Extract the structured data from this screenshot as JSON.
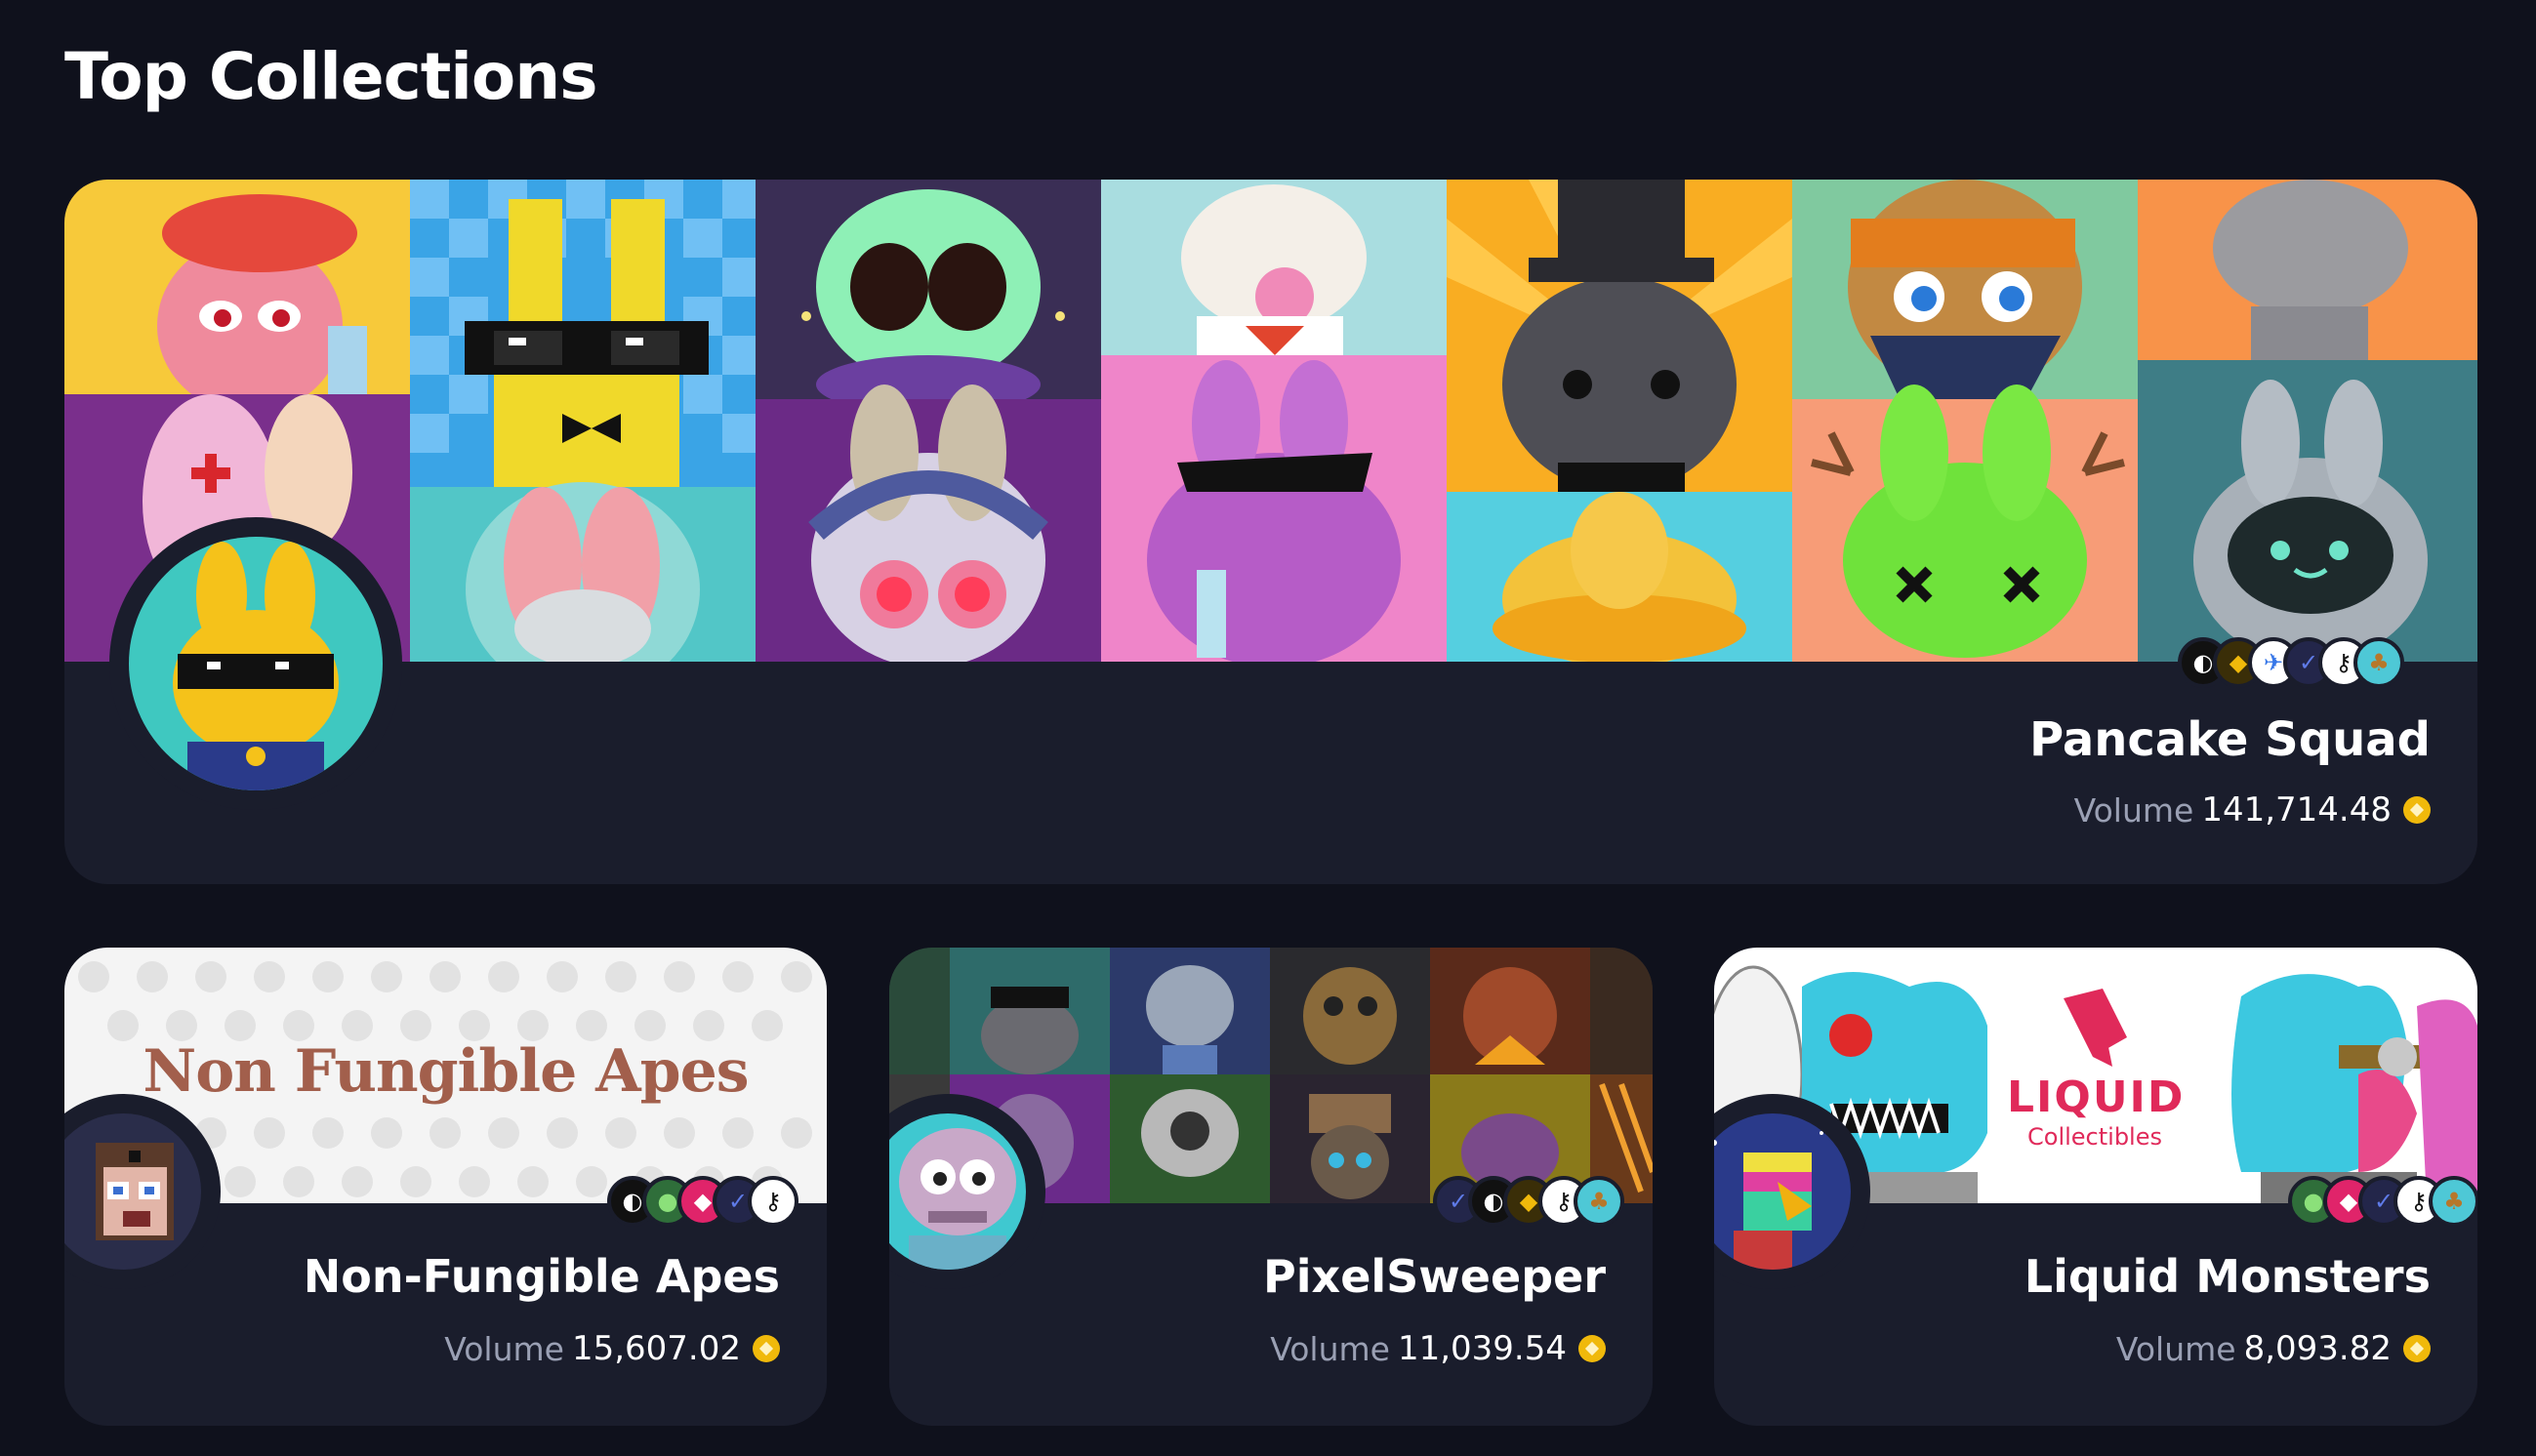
{
  "section": {
    "title": "Top Collections"
  },
  "featured": {
    "name": "Pancake Squad",
    "volume_label": "Volume",
    "volume_value": "141,714.48",
    "currency_icon": "bnb-coin-icon",
    "marketplace_icons": [
      "marketplace-icon",
      "binance-icon",
      "bird-icon",
      "arrow-icon",
      "key-icon",
      "pancakeswap-icon"
    ]
  },
  "collections": [
    {
      "name": "Non-Fungible Apes",
      "banner_text": "Non Fungible Apes",
      "volume_label": "Volume",
      "volume_value": "15,607.02",
      "currency_icon": "bnb-coin-icon",
      "marketplace_icons": [
        "marketplace-icon",
        "green-icon",
        "pink-icon",
        "arrow-icon",
        "key-icon"
      ]
    },
    {
      "name": "PixelSweeper",
      "volume_label": "Volume",
      "volume_value": "11,039.54",
      "currency_icon": "bnb-coin-icon",
      "marketplace_icons": [
        "arrow-icon",
        "marketplace-icon",
        "binance-icon",
        "key-icon",
        "pancakeswap-icon"
      ]
    },
    {
      "name": "Liquid Monsters",
      "banner_logo_line1": "LIQUID",
      "banner_logo_line2": "Collectibles",
      "volume_label": "Volume",
      "volume_value": "8,093.82",
      "currency_icon": "bnb-coin-icon",
      "marketplace_icons": [
        "green-icon",
        "pink-icon",
        "arrow-icon",
        "key-icon",
        "pancakeswap-icon"
      ]
    }
  ],
  "colors": {
    "background": "#0f111c",
    "card": "#1a1d2c",
    "muted_text": "#9aa0b4",
    "coin": "#f0b90b"
  }
}
